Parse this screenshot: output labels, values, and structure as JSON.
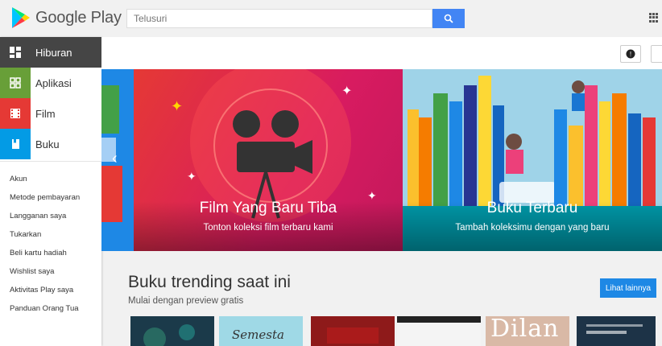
{
  "header": {
    "logo_text": "Google Play",
    "search_placeholder": "Telusuri"
  },
  "sidebar": {
    "categories": [
      {
        "label": "Hiburan",
        "icon": "grid-apps-icon",
        "color": "#454545"
      },
      {
        "label": "Aplikasi",
        "icon": "android-apps-icon",
        "color": "#689f38"
      },
      {
        "label": "Film",
        "icon": "film-icon",
        "color": "#e53935"
      },
      {
        "label": "Buku",
        "icon": "book-icon",
        "color": "#039be5"
      }
    ],
    "links": [
      "Akun",
      "Metode pembayaran",
      "Langganan saya",
      "Tukarkan",
      "Beli kartu hadiah",
      "Wishlist saya",
      "Aktivitas Play saya",
      "Panduan Orang Tua"
    ]
  },
  "banners": [
    {
      "title": "Film Yang Baru Tiba",
      "subtitle": "Tonton koleksi film terbaru kami"
    },
    {
      "title": "Buku Terbaru",
      "subtitle": "Tambah koleksimu dengan yang baru"
    }
  ],
  "section": {
    "title": "Buku trending saat ini",
    "subtitle": "Mulai dengan preview gratis",
    "see_all": "Lihat lainnya"
  },
  "books": [
    {
      "cover_text": "",
      "color": "#1b3a4a"
    },
    {
      "cover_text": "Semesta",
      "color": "#9fd9e6"
    },
    {
      "cover_text": "",
      "color": "#8e1a1a"
    },
    {
      "cover_text": "",
      "color": "#f4f4f4"
    },
    {
      "cover_text": "Dilan",
      "color": "#d9b9a6"
    },
    {
      "cover_text": "",
      "color": "#1d3347"
    }
  ],
  "colors": {
    "accent": "#1e88e5",
    "film_banner": "#e53935",
    "books_banner": "#9fd3e8"
  }
}
